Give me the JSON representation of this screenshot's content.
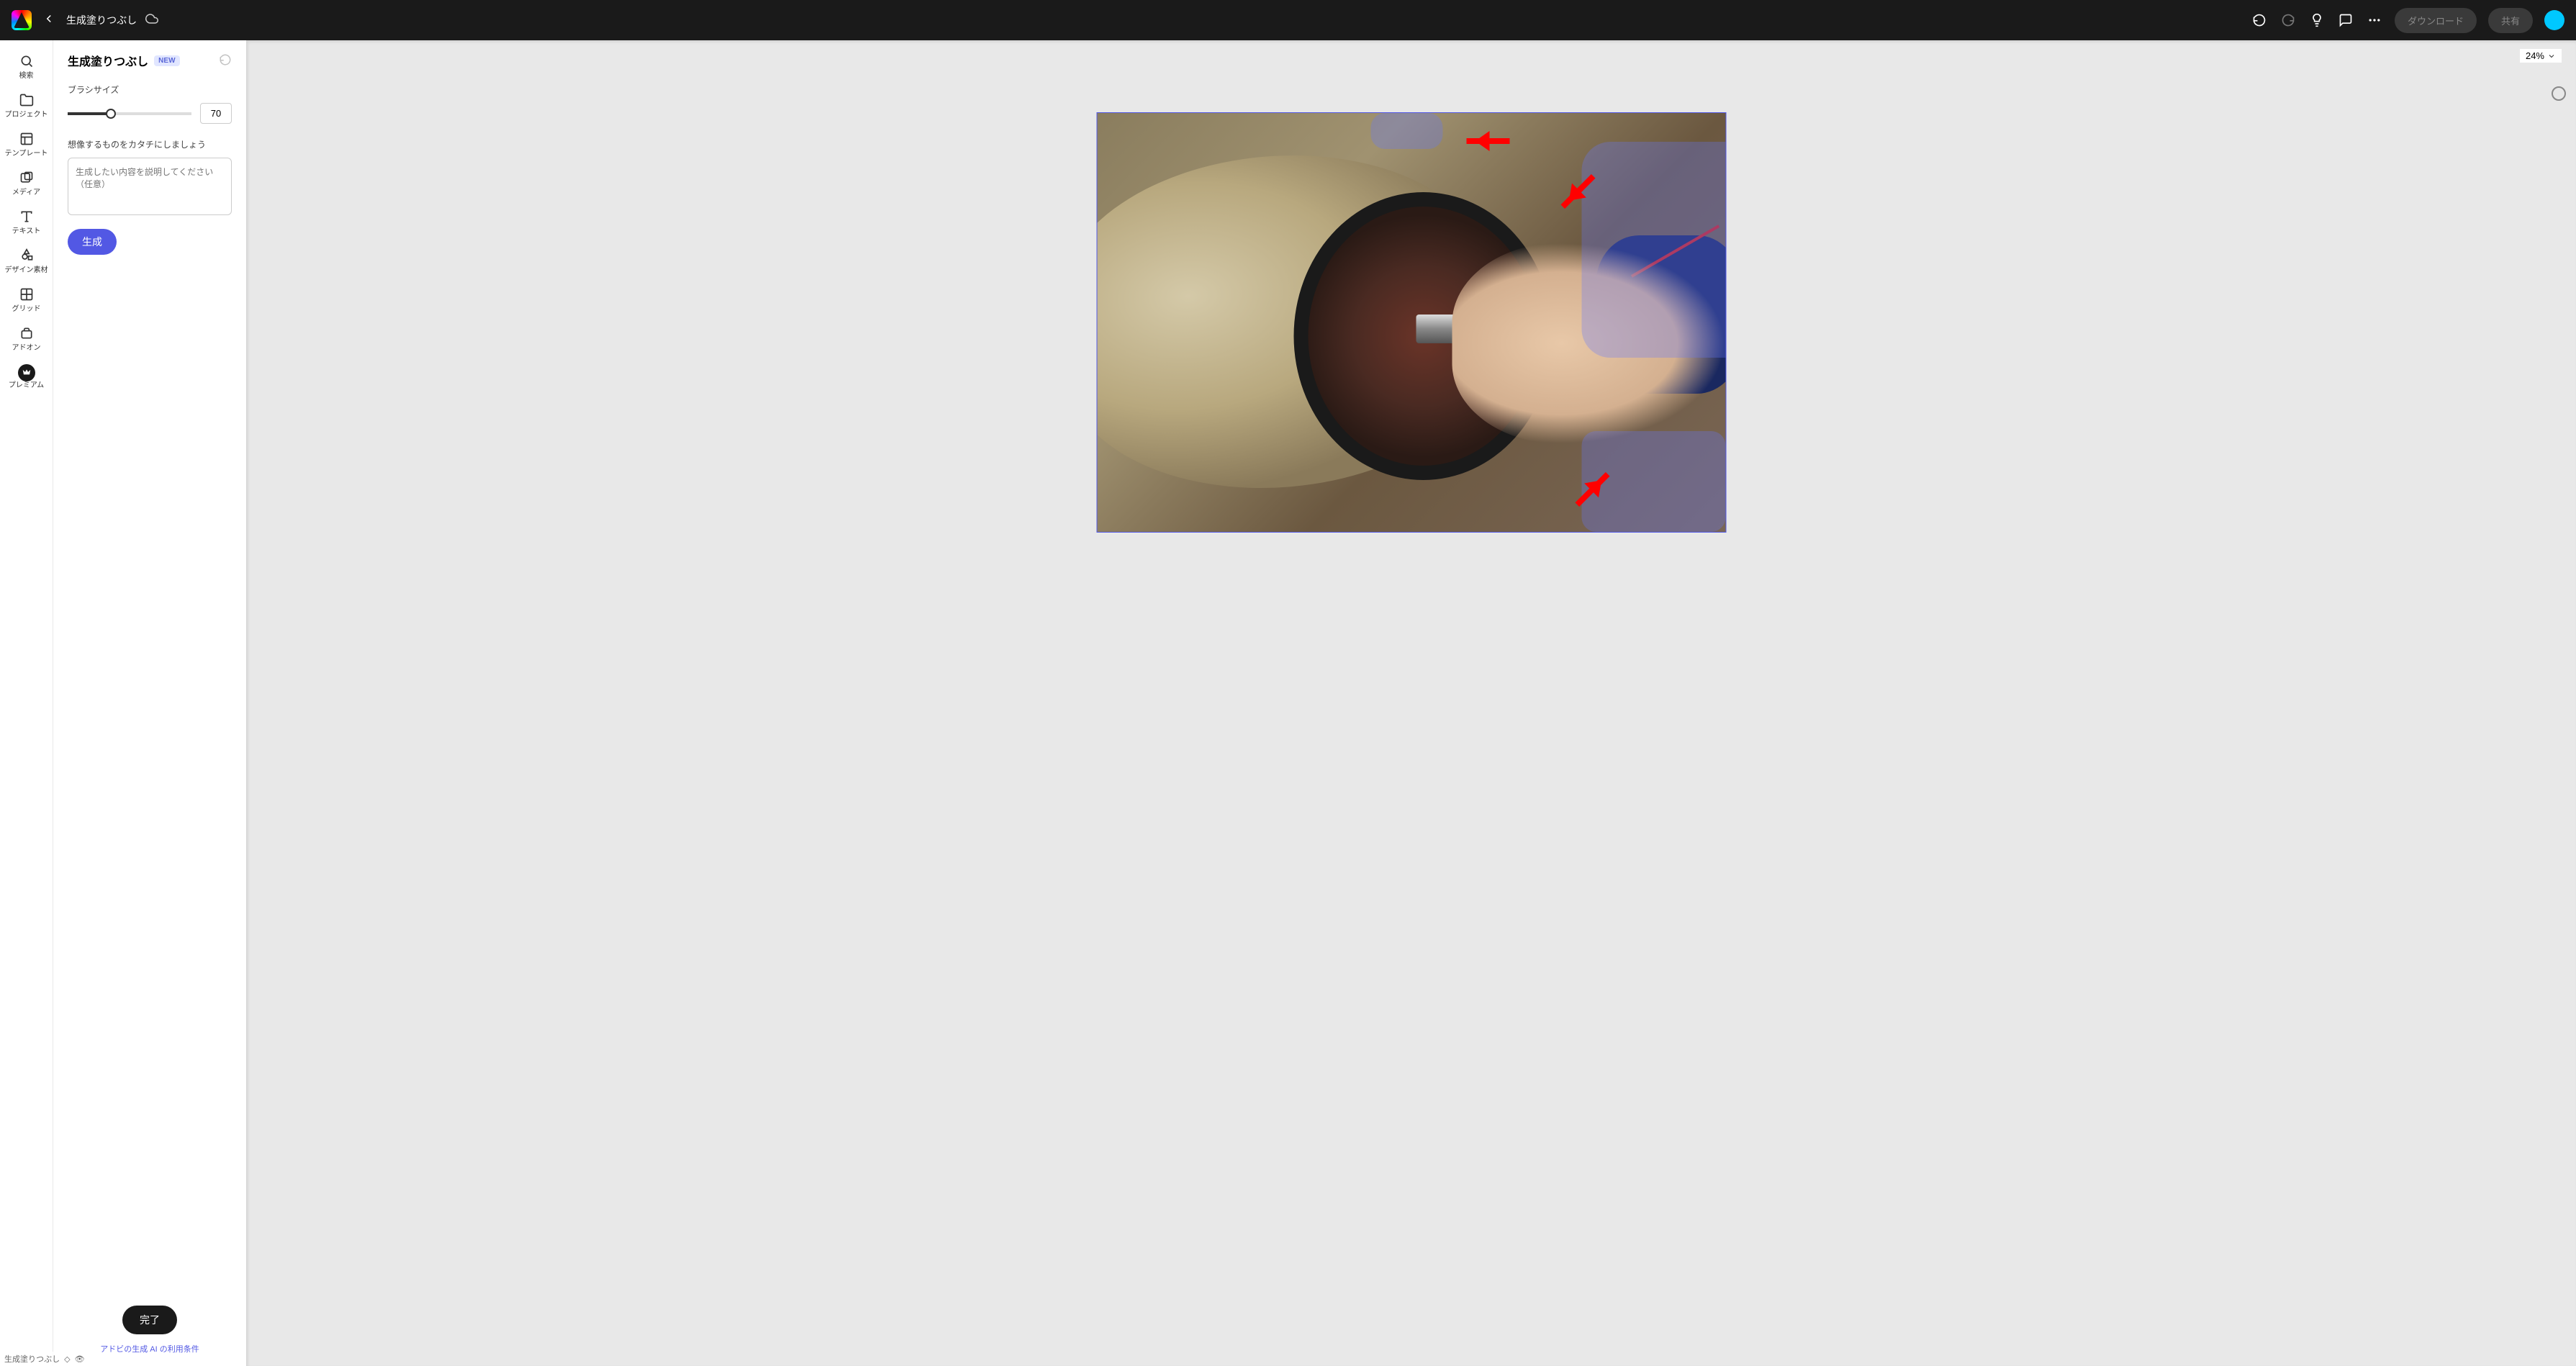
{
  "header": {
    "title": "生成塗りつぶし",
    "download_label": "ダウンロード",
    "share_label": "共有"
  },
  "rail": {
    "items": [
      {
        "label": "検索",
        "icon": "search"
      },
      {
        "label": "プロジェクト",
        "icon": "folder"
      },
      {
        "label": "テンプレート",
        "icon": "template"
      },
      {
        "label": "メディア",
        "icon": "media"
      },
      {
        "label": "テキスト",
        "icon": "text"
      },
      {
        "label": "デザイン素材",
        "icon": "shapes"
      },
      {
        "label": "グリッド",
        "icon": "grid"
      },
      {
        "label": "アドオン",
        "icon": "addon"
      },
      {
        "label": "プレミアム",
        "icon": "premium"
      }
    ]
  },
  "panel": {
    "title": "生成塗りつぶし",
    "badge": "NEW",
    "brush_size_label": "ブラシサイズ",
    "brush_size_value": "70",
    "prompt_label": "想像するものをカタチにしましょう",
    "prompt_placeholder": "生成したい内容を説明してください（任意）",
    "generate_label": "生成",
    "done_label": "完了",
    "terms_label": "アドビの生成 AI の利用条件"
  },
  "canvas": {
    "zoom_label": "24%"
  },
  "status": {
    "text": "生成塗りつぶし"
  }
}
